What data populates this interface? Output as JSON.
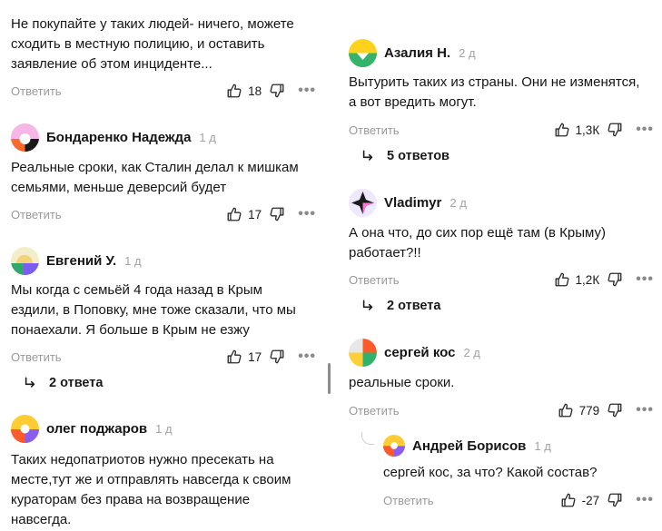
{
  "common": {
    "reply_label": "Ответить",
    "more_label": "•••"
  },
  "left": {
    "c0": {
      "text_lines": [
        "Не покупайте у таких людей- ничего, можете",
        "сходить в местную полицию, и оставить",
        "заявление об этом инциденте..."
      ],
      "likes": "18"
    },
    "c1": {
      "author": "Бондаренко Надежда",
      "ago": "1 д",
      "text_lines": [
        "Реальные сроки, как Сталин делал к мишкам",
        "семьями, меньше деверсий будет"
      ],
      "likes": "17"
    },
    "c2": {
      "author": "Евгений У.",
      "ago": "1 д",
      "text_lines": [
        "Мы когда с семьёй 4 года назад в Крым",
        "ездили, в Поповку, мне тоже сказали, что мы",
        "понаехали. Я больше в Крым не езжу"
      ],
      "likes": "17",
      "replies": "2 ответа"
    },
    "c3": {
      "author": "олег поджаров",
      "ago": "1 д",
      "text_lines": [
        "Таких недопатриотов нужно пресекать на",
        "месте,тут же и отправлять навсегда к своим",
        "кураторам без права на возвращение",
        "навсегда."
      ]
    }
  },
  "right": {
    "c0": {
      "author": "Азалия Н.",
      "ago": "2 д",
      "text_lines": [
        "Вытурить таких из страны. Они не изменятся,",
        "а вот вредить могут."
      ],
      "likes": "1,3К",
      "replies": "5 ответов"
    },
    "c1": {
      "author": "Vladimyr",
      "ago": "2 д",
      "text_lines": [
        "А она что, до сих пор ещё там (в Крыму)",
        "работает?!!"
      ],
      "likes": "1,2К",
      "replies": "2 ответа"
    },
    "c2": {
      "author": "сергей кос",
      "ago": "2 д",
      "text_lines": [
        "реальные сроки."
      ],
      "likes": "779"
    },
    "c3": {
      "author": "Андрей Борисов",
      "ago": "1 д",
      "text_lines": [
        "сергей кос, за что? Какой состав?"
      ],
      "likes": "-27"
    }
  },
  "icons": {
    "like": "thumbs-up-icon",
    "dislike": "thumbs-down-icon",
    "more": "more-dots-icon",
    "reply_arrow": "reply-arrow-icon"
  }
}
